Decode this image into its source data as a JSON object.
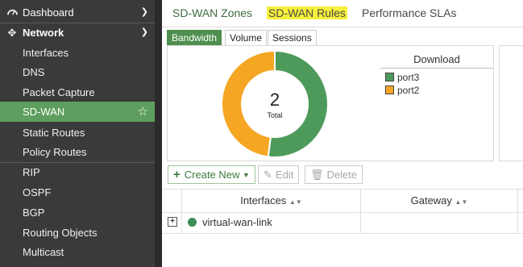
{
  "sidebar": {
    "items": [
      {
        "label": "Dashboard"
      },
      {
        "label": "Network"
      },
      {
        "label": "Interfaces"
      },
      {
        "label": "DNS"
      },
      {
        "label": "Packet Capture"
      },
      {
        "label": "SD-WAN"
      },
      {
        "label": "Static Routes"
      },
      {
        "label": "Policy Routes"
      },
      {
        "label": "RIP"
      },
      {
        "label": "OSPF"
      },
      {
        "label": "BGP"
      },
      {
        "label": "Routing Objects"
      },
      {
        "label": "Multicast"
      }
    ]
  },
  "tabs": [
    {
      "label": "SD-WAN Zones"
    },
    {
      "label": "SD-WAN Rules"
    },
    {
      "label": "Performance SLAs"
    }
  ],
  "segments": [
    {
      "label": "Bandwidth"
    },
    {
      "label": "Volume"
    },
    {
      "label": "Sessions"
    }
  ],
  "chart_data": {
    "type": "pie",
    "center_value": "2",
    "center_label": "Total",
    "legend_title": "Download",
    "legend": [
      {
        "name": "port3",
        "color": "#4e9a5a"
      },
      {
        "name": "port2",
        "color": "#f5a623"
      }
    ],
    "values": [
      52,
      48
    ]
  },
  "toolbar": {
    "create_new": "Create New",
    "edit": "Edit",
    "delete": "Delete"
  },
  "table": {
    "columns": [
      "Interfaces",
      "Gateway"
    ],
    "rows": [
      {
        "interfaces": "virtual-wan-link",
        "gateway": ""
      }
    ]
  },
  "colors": {
    "sidebar_bg": "#3a3a3a",
    "active_green": "#5e9e5e",
    "highlight_yellow": "#f6f03a"
  }
}
